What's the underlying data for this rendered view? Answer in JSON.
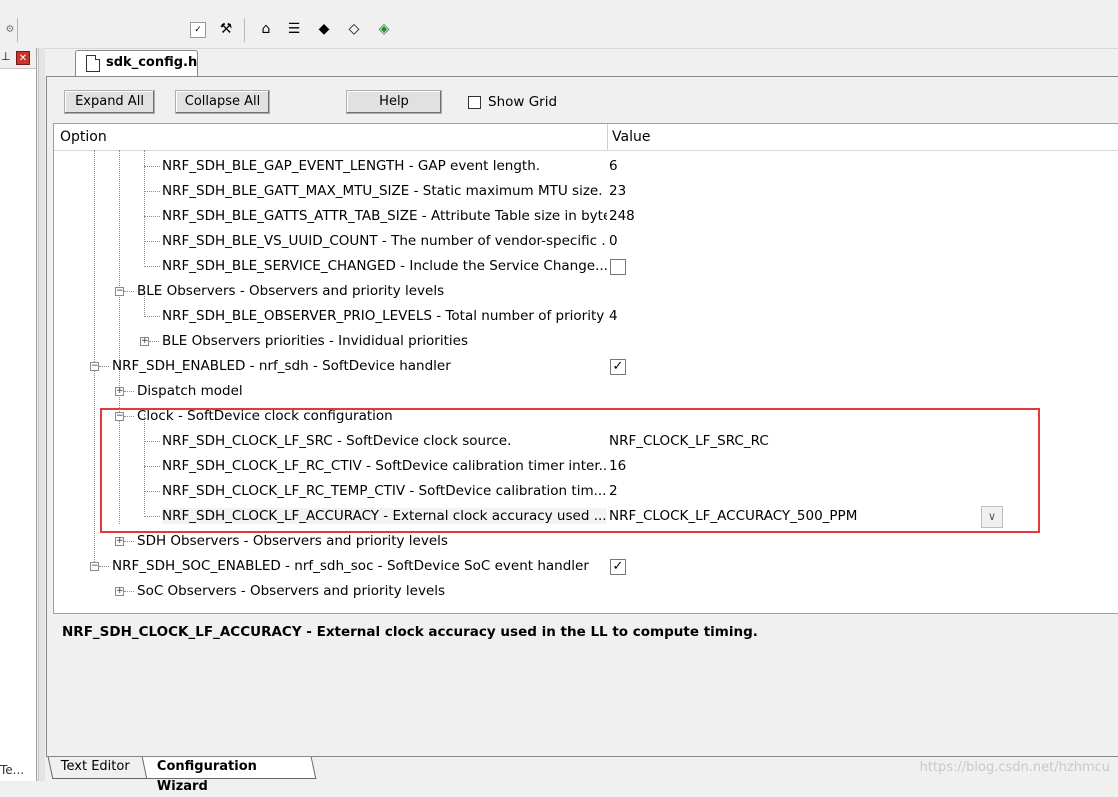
{
  "file_tab": {
    "label": "sdk_config.h"
  },
  "left_panel": {
    "tab_label": "Te..."
  },
  "toolbar": {
    "expand_all": "Expand All",
    "collapse_all": "Collapse All",
    "help": "Help",
    "show_grid": "Show Grid",
    "show_grid_checked": false
  },
  "grid": {
    "col_option": "Option",
    "col_value": "Value",
    "rows": [
      {
        "option": "NRF_SDH_BLE_GAP_EVENT_LENGTH - GAP event length.",
        "value": "6"
      },
      {
        "option": "NRF_SDH_BLE_GATT_MAX_MTU_SIZE - Static maximum MTU size.",
        "value": "23"
      },
      {
        "option": "NRF_SDH_BLE_GATTS_ATTR_TAB_SIZE - Attribute Table size in byte...",
        "value": "248"
      },
      {
        "option": "NRF_SDH_BLE_VS_UUID_COUNT - The number of vendor-specific ...",
        "value": "0"
      },
      {
        "option": "NRF_SDH_BLE_SERVICE_CHANGED  - Include the Service Change...",
        "value": ""
      },
      {
        "option": "BLE Observers - Observers and priority levels",
        "value": ""
      },
      {
        "option": "NRF_SDH_BLE_OBSERVER_PRIO_LEVELS - Total number of priority ...",
        "value": "4"
      },
      {
        "option": "BLE Observers priorities - Invididual priorities",
        "value": ""
      },
      {
        "option": "NRF_SDH_ENABLED - nrf_sdh - SoftDevice handler",
        "value": ""
      },
      {
        "option": "Dispatch model",
        "value": ""
      },
      {
        "option": "Clock - SoftDevice clock configuration",
        "value": ""
      },
      {
        "option": "NRF_SDH_CLOCK_LF_SRC  - SoftDevice clock source.",
        "value": "NRF_CLOCK_LF_SRC_RC"
      },
      {
        "option": "NRF_SDH_CLOCK_LF_RC_CTIV - SoftDevice calibration timer inter...",
        "value": "16"
      },
      {
        "option": "NRF_SDH_CLOCK_LF_RC_TEMP_CTIV - SoftDevice calibration tim...",
        "value": "2"
      },
      {
        "option": "NRF_SDH_CLOCK_LF_ACCURACY  - External clock accuracy used ...",
        "value": "NRF_CLOCK_LF_ACCURACY_500_PPM"
      },
      {
        "option": "SDH Observers - Observers and priority levels",
        "value": ""
      },
      {
        "option": "NRF_SDH_SOC_ENABLED - nrf_sdh_soc - SoftDevice SoC event handler",
        "value": ""
      },
      {
        "option": "SoC Observers - Observers and priority levels",
        "value": ""
      }
    ],
    "checkbox_states": {
      "service_changed": false,
      "sdh_enabled": true,
      "soc_enabled": true
    }
  },
  "description": "NRF_SDH_CLOCK_LF_ACCURACY  - External clock accuracy used in the LL to compute timing.",
  "bottom_tabs": {
    "text_editor": "Text Editor",
    "config_wizard": "Configuration Wizard"
  },
  "watermark": "https://blog.csdn.net/hzhmcu",
  "colors": {
    "highlight_box": "#e23a3a"
  }
}
